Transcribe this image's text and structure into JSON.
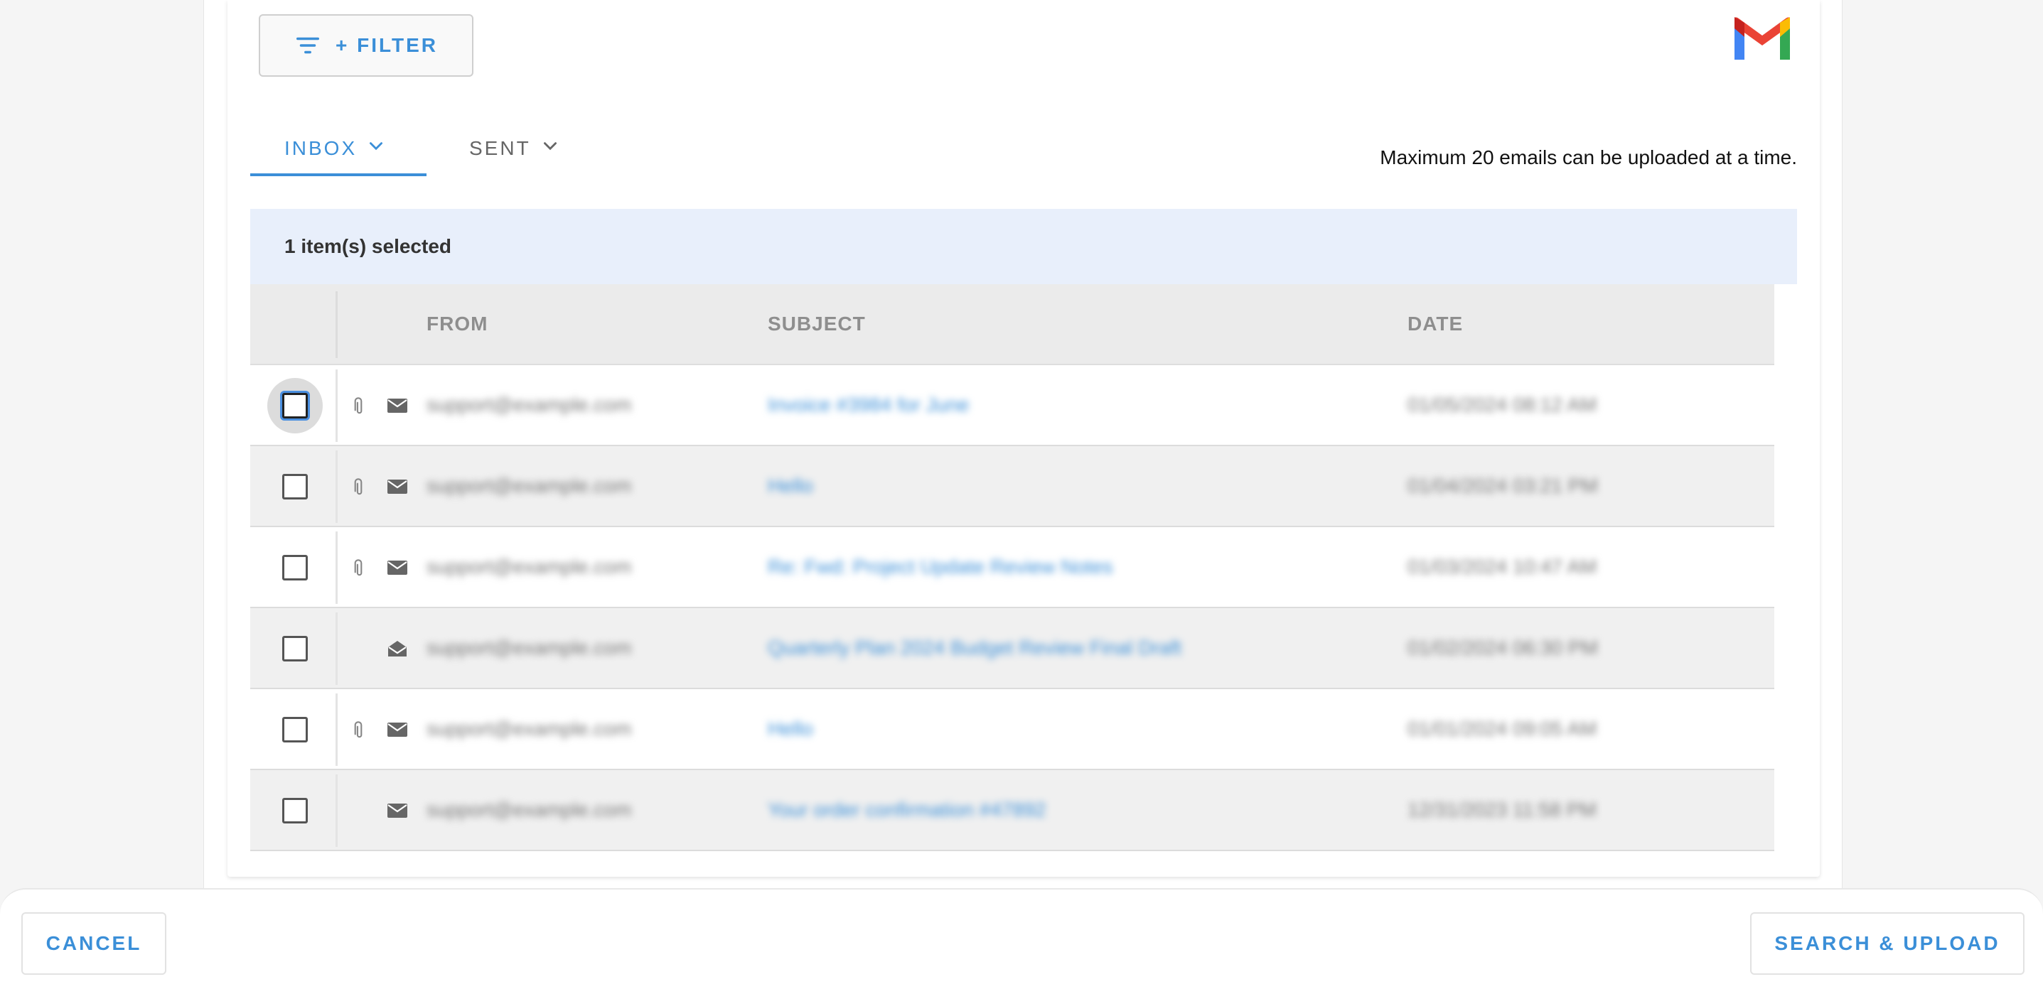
{
  "toolbar": {
    "filter_label": "+ FILTER",
    "filter_icon": "filter-icon",
    "logo": "gmail-logo"
  },
  "tabs": [
    {
      "label": "INBOX",
      "active": true,
      "icon": "chevron-down-icon"
    },
    {
      "label": "SENT",
      "active": false,
      "icon": "chevron-down-icon"
    }
  ],
  "notice": "Maximum 20 emails can be uploaded at a time.",
  "selection": {
    "text": "1 item(s) selected"
  },
  "table": {
    "columns": {
      "from": "FROM",
      "subject": "SUBJECT",
      "date": "DATE"
    },
    "rows": [
      {
        "has_attachment": true,
        "mail_icon": "mail-icon",
        "from": "support@example.com",
        "subject": "Invoice #3984 for June",
        "date": "01/05/2024 08:12 AM",
        "focused": true
      },
      {
        "has_attachment": true,
        "mail_icon": "mail-icon",
        "from": "support@example.com",
        "subject": "Hello",
        "date": "01/04/2024 03:21 PM",
        "focused": false
      },
      {
        "has_attachment": true,
        "mail_icon": "mail-icon",
        "from": "support@example.com",
        "subject": "Re: Fwd: Project Update Review Notes",
        "date": "01/03/2024 10:47 AM",
        "focused": false
      },
      {
        "has_attachment": false,
        "mail_icon": "mail-open-icon",
        "from": "support@example.com",
        "subject": "Quarterly Plan 2024 Budget Review Final Draft",
        "date": "01/02/2024 06:30 PM",
        "focused": false
      },
      {
        "has_attachment": true,
        "mail_icon": "mail-icon",
        "from": "support@example.com",
        "subject": "Hello",
        "date": "01/01/2024 09:05 AM",
        "focused": false
      },
      {
        "has_attachment": false,
        "mail_icon": "mail-icon",
        "from": "support@example.com",
        "subject": "Your order confirmation #47892",
        "date": "12/31/2023 11:58 PM",
        "focused": false
      }
    ]
  },
  "footer": {
    "cancel_label": "CANCEL",
    "upload_label": "SEARCH & UPLOAD"
  },
  "colors": {
    "accent": "#3b8fd8",
    "selected_bar": "#e8effb",
    "header_bg": "#ebebeb"
  }
}
